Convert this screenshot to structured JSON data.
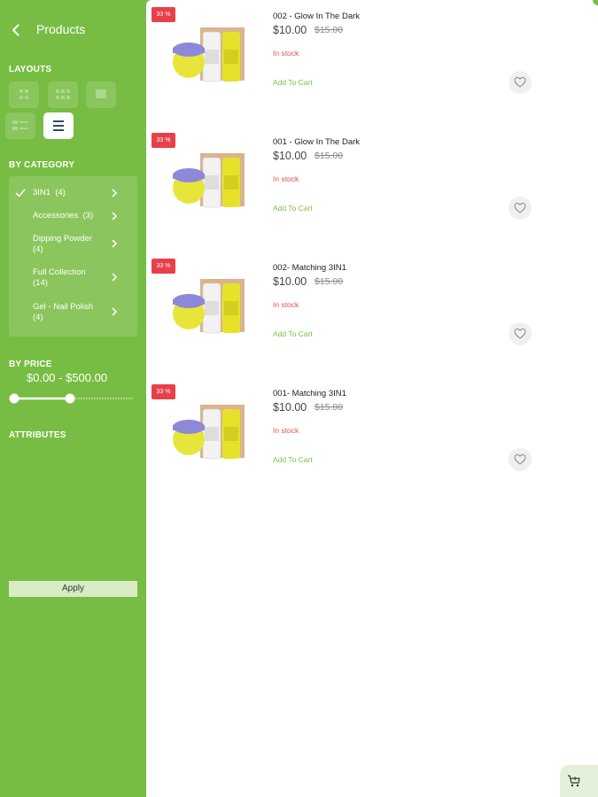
{
  "header": {
    "title": "Products",
    "back_icon": "chevron-left-icon"
  },
  "sidebar": {
    "layouts_label": "LAYOUTS",
    "layouts": [
      {
        "icon": "grid-2col-icon",
        "active": false
      },
      {
        "icon": "grid-3col-icon",
        "active": false
      },
      {
        "icon": "grid-1col-icon",
        "active": false
      },
      {
        "icon": "list-thumb-icon",
        "active": false
      },
      {
        "icon": "list-icon",
        "active": true
      }
    ],
    "category_label": "BY CATEGORY",
    "categories": [
      {
        "name": "3IN1",
        "count": "(4)",
        "checked": true
      },
      {
        "name": "Accessories",
        "count": "(3)",
        "checked": false
      },
      {
        "name": "Dipping Powder",
        "count": "(4)",
        "checked": false
      },
      {
        "name": "Full Collection",
        "count": "(14)",
        "checked": false
      },
      {
        "name": "Gel - Nail Polish",
        "count": "(4)",
        "checked": false
      }
    ],
    "price_label": "BY PRICE",
    "price_range": "$0.00 - $500.00",
    "price_slider": {
      "min": 0,
      "max": 500,
      "selected_fraction": 0.47
    },
    "attributes_label": "ATTRIBUTES",
    "apply_label": "Apply"
  },
  "products": [
    {
      "badge": "33 %",
      "name": "002 - Glow In The Dark",
      "price": "$10.00",
      "old_price": "$15.00",
      "stock": "In stock",
      "add_to_cart": "Add To Cart"
    },
    {
      "badge": "33 %",
      "name": "001 - Glow In The Dark",
      "price": "$10.00",
      "old_price": "$15.00",
      "stock": "In stock",
      "add_to_cart": "Add To Cart"
    },
    {
      "badge": "33 %",
      "name": "002- Matching 3IN1",
      "price": "$10.00",
      "old_price": "$15.00",
      "stock": "In stock",
      "add_to_cart": "Add To Cart"
    },
    {
      "badge": "33 %",
      "name": "001- Matching 3IN1",
      "price": "$10.00",
      "old_price": "$15.00",
      "stock": "In stock",
      "add_to_cart": "Add To Cart"
    }
  ],
  "colors": {
    "brand_green": "#77bd43",
    "sale_red": "#e8404a",
    "stock_red": "#e65151",
    "cart_green": "#7cc046"
  },
  "fab": {
    "icon": "cart-icon"
  }
}
